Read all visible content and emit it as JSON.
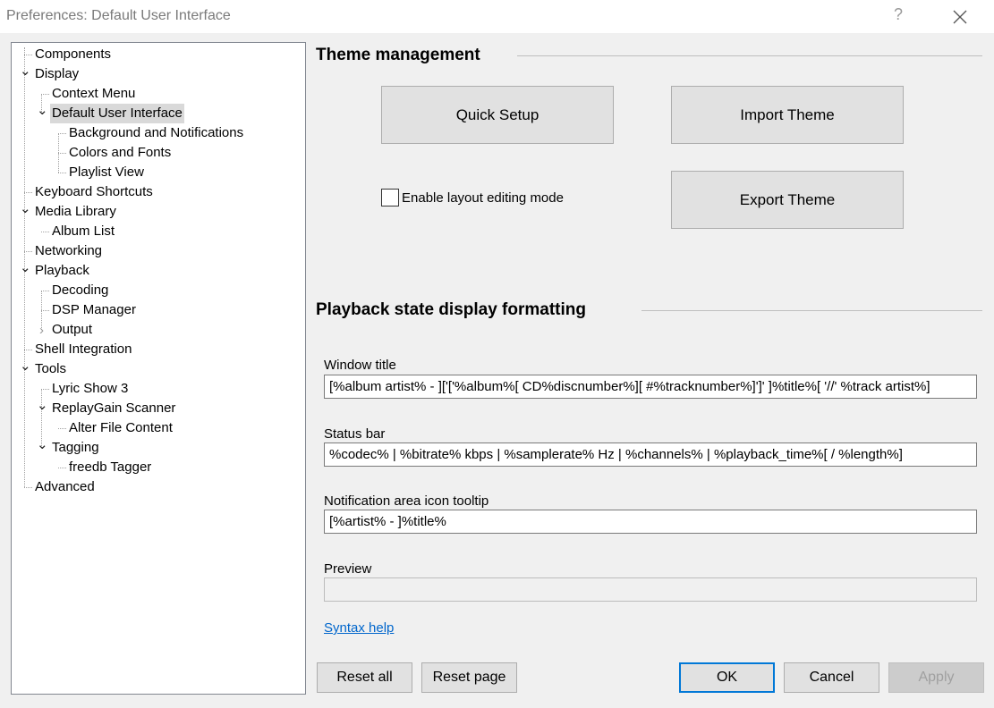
{
  "window": {
    "title": "Preferences: Default User Interface",
    "help_glyph": "?"
  },
  "tree": [
    {
      "label": "Components",
      "depth": 0
    },
    {
      "label": "Display",
      "depth": 0,
      "expander": "expanded"
    },
    {
      "label": "Context Menu",
      "depth": 1
    },
    {
      "label": "Default User Interface",
      "depth": 1,
      "expander": "expanded",
      "selected": true
    },
    {
      "label": "Background and Notifications",
      "depth": 2
    },
    {
      "label": "Colors and Fonts",
      "depth": 2
    },
    {
      "label": "Playlist View",
      "depth": 2
    },
    {
      "label": "Keyboard Shortcuts",
      "depth": 0
    },
    {
      "label": "Media Library",
      "depth": 0,
      "expander": "expanded"
    },
    {
      "label": "Album List",
      "depth": 1
    },
    {
      "label": "Networking",
      "depth": 0
    },
    {
      "label": "Playback",
      "depth": 0,
      "expander": "expanded"
    },
    {
      "label": "Decoding",
      "depth": 1
    },
    {
      "label": "DSP Manager",
      "depth": 1
    },
    {
      "label": "Output",
      "depth": 1,
      "expander": "collapsed"
    },
    {
      "label": "Shell Integration",
      "depth": 0
    },
    {
      "label": "Tools",
      "depth": 0,
      "expander": "expanded"
    },
    {
      "label": "Lyric Show 3",
      "depth": 1
    },
    {
      "label": "ReplayGain Scanner",
      "depth": 1,
      "expander": "expanded"
    },
    {
      "label": "Alter File Content",
      "depth": 2
    },
    {
      "label": "Tagging",
      "depth": 1,
      "expander": "expanded"
    },
    {
      "label": "freedb Tagger",
      "depth": 2
    },
    {
      "label": "Advanced",
      "depth": 0
    }
  ],
  "theme": {
    "heading": "Theme management",
    "quick_setup": "Quick Setup",
    "import_theme": "Import Theme",
    "export_theme": "Export Theme",
    "layout_editing_label": "Enable layout editing mode",
    "layout_editing_checked": false
  },
  "formatting": {
    "heading": "Playback state display formatting",
    "window_title_label": "Window title",
    "window_title_value": "[%album artist% - ]['['%album%[ CD%discnumber%][ #%tracknumber%]']' ]%title%[ '//' %track artist%]",
    "status_bar_label": "Status bar",
    "status_bar_value": "%codec% | %bitrate% kbps | %samplerate% Hz | %channels% | %playback_time%[ / %length%]",
    "tooltip_label": "Notification area icon tooltip",
    "tooltip_value": "[%artist% - ]%title%",
    "preview_label": "Preview",
    "preview_value": "",
    "syntax_help": "Syntax help"
  },
  "buttons": {
    "reset_all": "Reset all",
    "reset_page": "Reset page",
    "ok": "OK",
    "cancel": "Cancel",
    "apply": "Apply"
  },
  "colors": {
    "selection": "#d9d9d9",
    "link": "#0066cc",
    "default_button_border": "#0078d7"
  }
}
